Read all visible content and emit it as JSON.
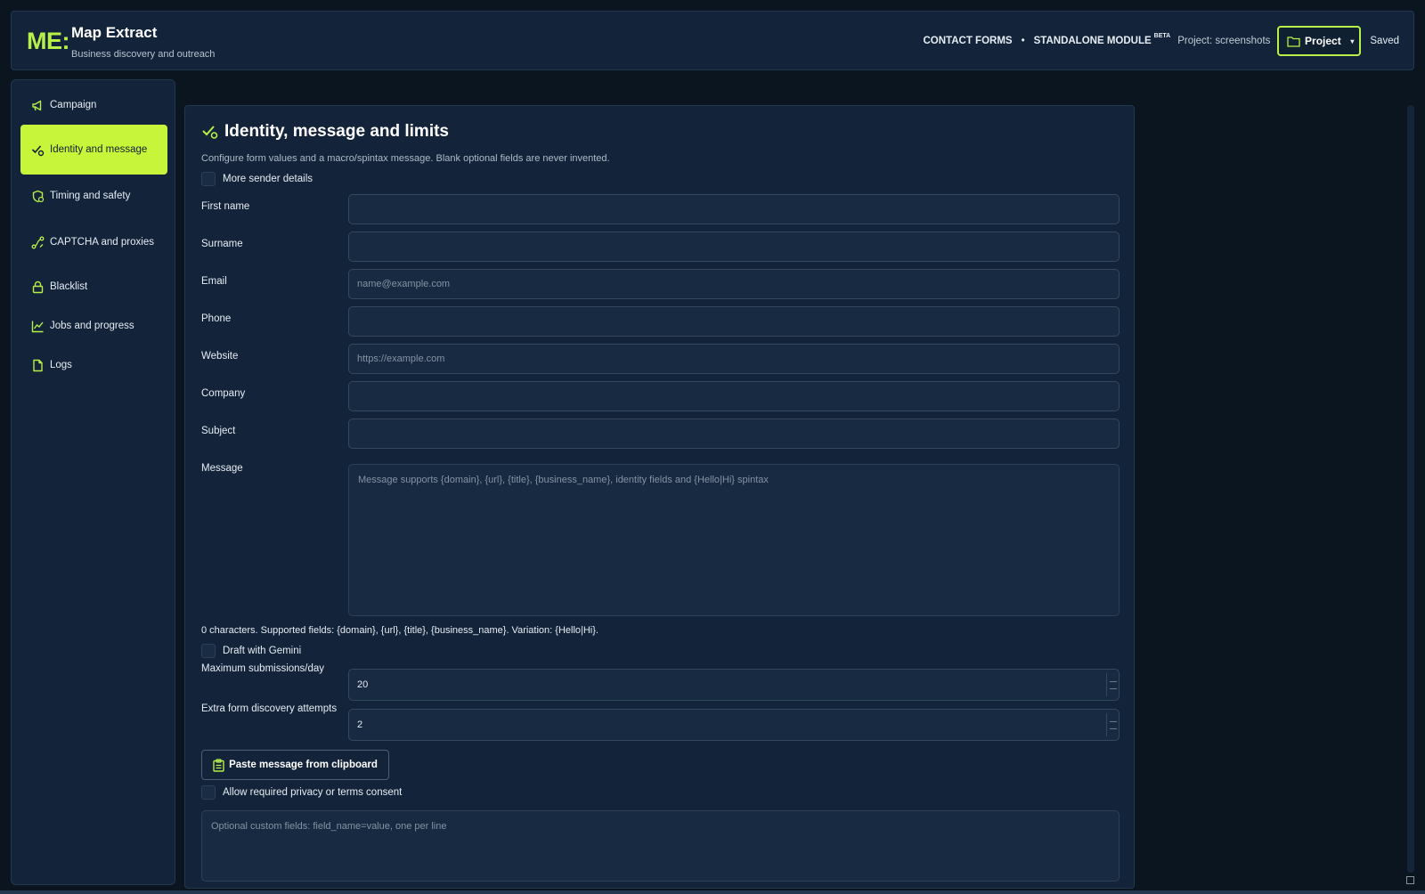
{
  "header": {
    "logo": "ME:",
    "title": "Map Extract",
    "subtitle": "Business discovery and outreach",
    "nav_contact_forms": "CONTACT FORMS",
    "separator": "•",
    "nav_standalone": "STANDALONE MODULE",
    "beta_badge": "BETA",
    "project_text": "Project: screenshots",
    "project_button": "Project",
    "status": "Saved"
  },
  "sidebar": {
    "items": [
      {
        "label": "Campaign",
        "icon": "megaphone-icon"
      },
      {
        "label": "Identity and message",
        "icon": "check-badge-icon",
        "active": true
      },
      {
        "label": "Timing and safety",
        "icon": "shield-clock-icon"
      },
      {
        "label": "CAPTCHA and proxies",
        "icon": "route-icon"
      },
      {
        "label": "Blacklist",
        "icon": "lock-icon"
      },
      {
        "label": "Jobs and progress",
        "icon": "chart-line-icon"
      },
      {
        "label": "Logs",
        "icon": "file-icon"
      }
    ]
  },
  "panel": {
    "title": "Identity, message and limits",
    "description": "Configure form values and a macro/spintax message. Blank optional fields are never invented.",
    "more_sender_details": "More sender details",
    "fields": {
      "first_name": {
        "label": "First name",
        "value": "",
        "placeholder": ""
      },
      "surname": {
        "label": "Surname",
        "value": "",
        "placeholder": ""
      },
      "email": {
        "label": "Email",
        "value": "",
        "placeholder": "name@example.com"
      },
      "phone": {
        "label": "Phone",
        "value": "",
        "placeholder": ""
      },
      "website": {
        "label": "Website",
        "value": "",
        "placeholder": "https://example.com"
      },
      "company": {
        "label": "Company",
        "value": "",
        "placeholder": ""
      },
      "subject": {
        "label": "Subject",
        "value": "",
        "placeholder": ""
      },
      "message": {
        "label": "Message",
        "value": "",
        "placeholder": "Message supports {domain}, {url}, {title}, {business_name}, identity fields and {Hello|Hi} spintax"
      }
    },
    "char_count": "0 characters. Supported fields: {domain}, {url}, {title}, {business_name}. Variation: {Hello|Hi}.",
    "draft_gemini": "Draft with Gemini",
    "max_submissions": {
      "label": "Maximum submissions/day",
      "value": "20"
    },
    "extra_attempts": {
      "label": "Extra form discovery attempts",
      "value": "2"
    },
    "paste_button": "Paste message from clipboard",
    "allow_consent": "Allow required privacy or terms consent",
    "custom_fields_placeholder": "Optional custom fields: field_name=value, one per line"
  },
  "colors": {
    "accent": "#c6f53a",
    "background": "#0a1520",
    "panel": "#13243a"
  }
}
